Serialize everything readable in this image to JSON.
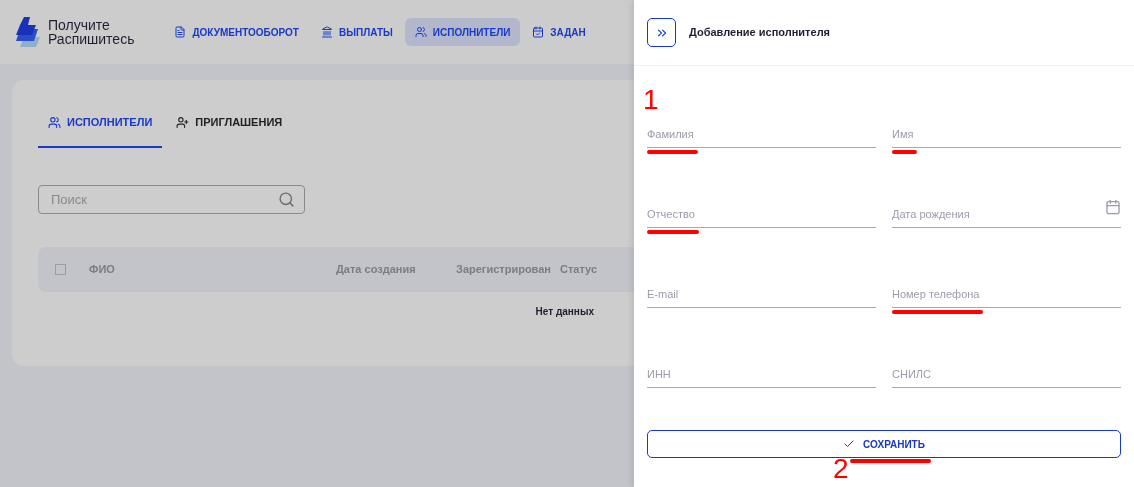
{
  "logo": {
    "lines": [
      "Получите",
      "Распишитесь"
    ]
  },
  "nav": [
    {
      "label": "ДОКУМЕНТООБОРОТ",
      "selected": false
    },
    {
      "label": "ВЫПЛАТЫ",
      "selected": false
    },
    {
      "label": "ИСПОЛНИТЕЛИ",
      "selected": true
    },
    {
      "label": "ЗАДАН",
      "selected": false
    }
  ],
  "tabs": [
    {
      "label": "ИСПОЛНИТЕЛИ",
      "selected": true
    },
    {
      "label": "ПРИГЛАШЕНИЯ",
      "selected": false
    }
  ],
  "search": {
    "placeholder": "Поиск"
  },
  "table": {
    "select_all_checked": false,
    "columns": [
      "ФИО",
      "Дата создания",
      "Зарегистрирован",
      "Статус"
    ],
    "empty_text": "Нет данных"
  },
  "drawer": {
    "title": "Добавление исполнителя",
    "annotation": "1",
    "fields": [
      {
        "label": "Фамилия",
        "kind": "text",
        "marked": true
      },
      {
        "label": "Имя",
        "kind": "text",
        "marked": true
      },
      {
        "label": "Отчество",
        "kind": "text",
        "marked": true
      },
      {
        "label": "Дата рождения",
        "kind": "date",
        "marked": false
      },
      {
        "label": "E-mail",
        "kind": "text",
        "marked": false
      },
      {
        "label": "Номер телефона",
        "kind": "text",
        "marked": true
      },
      {
        "label": "ИНН",
        "kind": "text",
        "marked": false
      },
      {
        "label": "СНИЛС",
        "kind": "text",
        "marked": false
      }
    ],
    "save_button": {
      "label": "СОХРАНИТЬ",
      "marked": true,
      "annotation": "2"
    }
  }
}
